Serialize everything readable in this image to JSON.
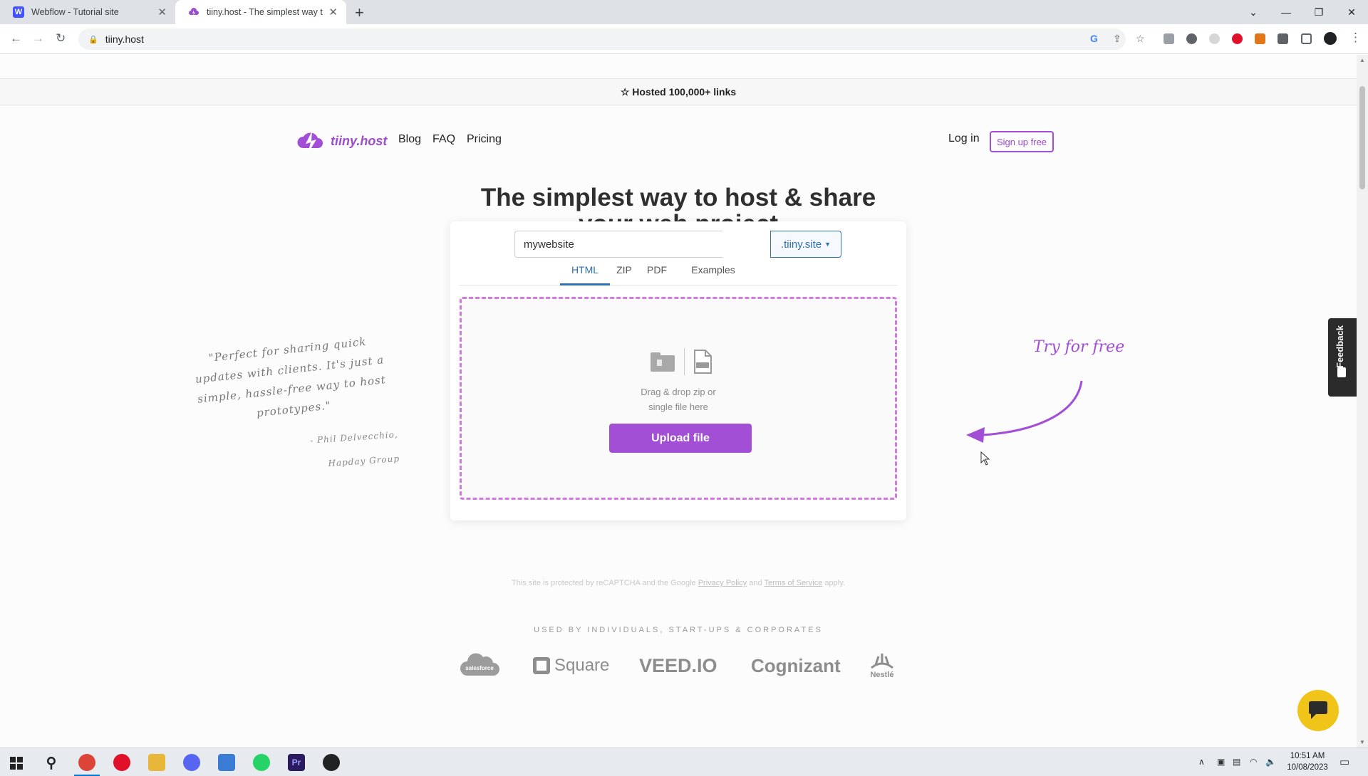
{
  "browser": {
    "tabs": [
      {
        "title": "Webflow - Tutorial site",
        "favicon": "webflow-icon"
      },
      {
        "title": "tiiny.host - The simplest way to s",
        "favicon": "tiiny-cloud-icon"
      }
    ],
    "url": "tiiny.host"
  },
  "page": {
    "announcement": "☆ Hosted 100,000+ links",
    "brand": "tiiny.host",
    "nav": [
      "Blog",
      "FAQ",
      "Pricing"
    ],
    "login": "Log in",
    "signup": "Sign up free",
    "hero": "The simplest way to host & share your web project",
    "form": {
      "subdomain_value": "mywebsite",
      "tld": ".tiiny.site",
      "tabs": [
        "HTML",
        "ZIP",
        "PDF",
        "Examples"
      ],
      "active_tab": "HTML",
      "drop_text_1": "Drag & drop zip or",
      "drop_text_2": "single file here",
      "upload_label": "Upload file"
    },
    "recaptcha": {
      "pre": "This site is protected by reCAPTCHA and the Google",
      "privacy": "Privacy Policy",
      "and": "and",
      "terms": "Terms of Service",
      "post": "apply."
    },
    "quote": {
      "text": "\"Perfect for sharing quick updates with clients. It's just a simple, hassle-free way to host prototypes.\"",
      "author": "- Phil Delvecchio,",
      "company": "Hapday Group"
    },
    "try_free": "Try for free",
    "feedback": "Feedback",
    "used_by": "USED BY INDIVIDUALS, START-UPS & CORPORATES",
    "logos": [
      "salesforce",
      "Square",
      "VEED.IO",
      "Cognizant",
      "Nestlé"
    ]
  },
  "taskbar": {
    "time": "10:51 AM",
    "date": "10/08/2023"
  },
  "colors": {
    "brand_purple": "#a24fd6",
    "tab_blue": "#2f6fb3",
    "chat_yellow": "#f0c419"
  }
}
